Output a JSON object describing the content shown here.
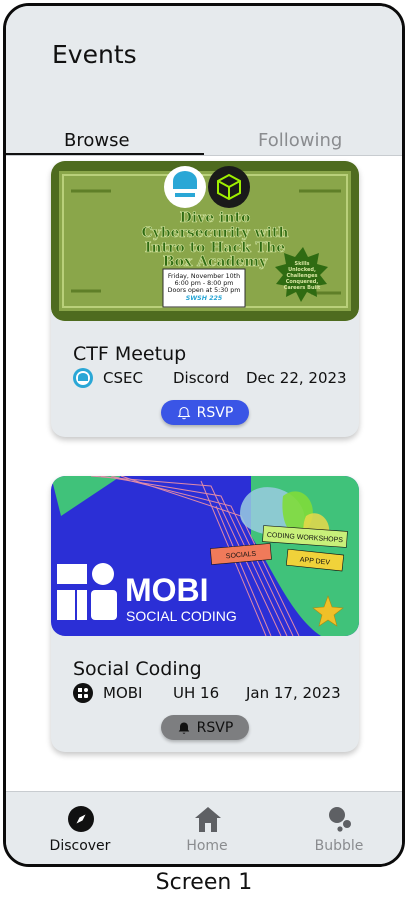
{
  "header": {
    "title": "Events"
  },
  "tabs": [
    {
      "label": "Browse",
      "active": true
    },
    {
      "label": "Following",
      "active": false
    }
  ],
  "events": [
    {
      "title": "CTF Meetup",
      "org": "CSEC",
      "location": "Discord",
      "date": "Dec 22, 2023",
      "rsvp_label": "RSVP",
      "rsvp_color": "#3a55e6",
      "banner": {
        "headline_lines": [
          "Dive into",
          "Cybersecurity with",
          "Intro to Hack The",
          "Box Academy"
        ],
        "info_lines": [
          "Friday, November 10th",
          "6:00 pm - 8:00 pm",
          "Doors open at 5:30 pm",
          "SWSH 225"
        ],
        "badge_lines": [
          "Skills",
          "Unlocked,",
          "Challenges",
          "Conquered,",
          "Careers Built"
        ],
        "icons": [
          "shield-logo-icon",
          "hack-the-box-cube-icon"
        ],
        "bg_color": "#8aa64a",
        "headline_color": "#2f6b12"
      }
    },
    {
      "title": "Social Coding",
      "org": "MOBI",
      "location": "UH 16",
      "date": "Jan 17, 2023",
      "rsvp_label": "RSVP",
      "rsvp_color": "#7d7e80",
      "banner": {
        "brand": "MOBI",
        "tagline": "SOCIAL CODING",
        "tags": [
          "CODING WORKSHOPS",
          "SOCIALS",
          "APP DEV"
        ],
        "bg_color": "#2b2fd6",
        "accent_color": "#40c27a"
      }
    }
  ],
  "bottom_nav": [
    {
      "label": "Discover",
      "icon": "compass-icon",
      "active": true
    },
    {
      "label": "Home",
      "icon": "home-icon",
      "active": false
    },
    {
      "label": "Bubble",
      "icon": "bubble-icon",
      "active": false
    }
  ],
  "caption": "Screen 1"
}
